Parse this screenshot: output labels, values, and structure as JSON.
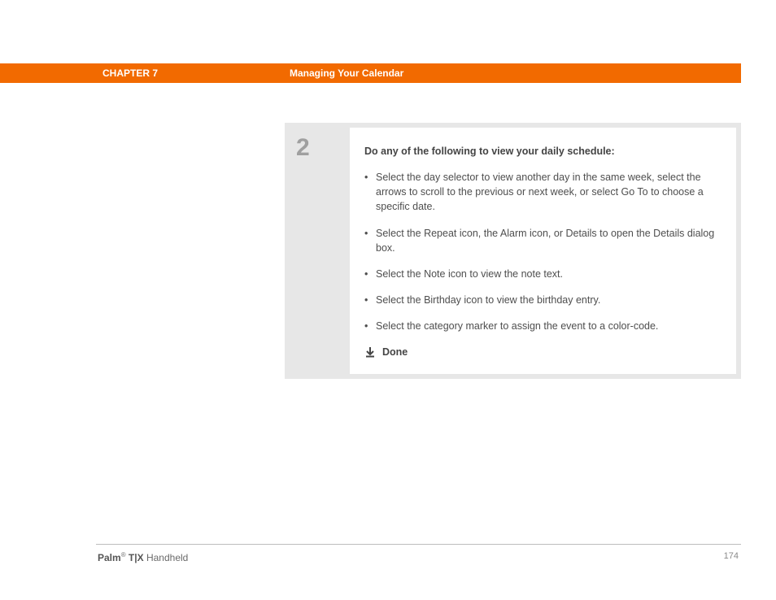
{
  "header": {
    "chapter": "CHAPTER 7",
    "title": "Managing Your Calendar"
  },
  "step": {
    "number": "2",
    "lead": "Do any of the following to view your daily schedule:",
    "bullets": [
      "Select the day selector to view another day in the same week, select the arrows to scroll to the previous or next week, or select Go To to choose a specific date.",
      "Select the Repeat icon, the Alarm icon, or Details to open the Details dialog box.",
      "Select the Note icon to view the note text.",
      "Select the Birthday icon to view the birthday entry.",
      "Select the category marker to assign the event to a color-code."
    ],
    "done": "Done"
  },
  "footer": {
    "brand": "Palm",
    "reg": "®",
    "model": " T|X",
    "tail": " Handheld",
    "page": "174"
  }
}
